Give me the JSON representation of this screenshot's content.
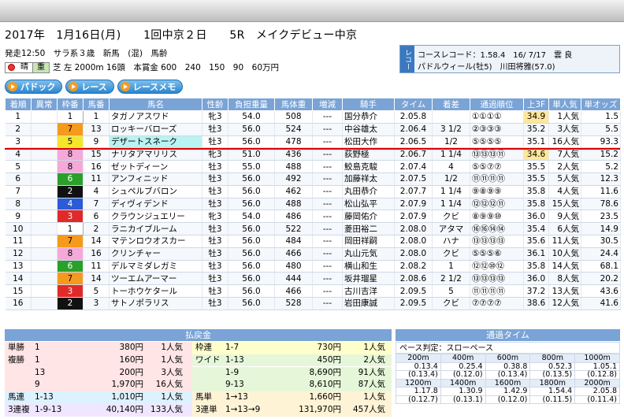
{
  "race": {
    "title": "2017年　1月16日(月)　　1回中京２日　　5R　メイクデビュー中京",
    "info1": "発走12:50　サラ系３歳　新馬　(混)　馬齢",
    "weather": "晴",
    "ground": "重",
    "info2": "芝 左 2000m 16頭　本賞金 600　240　150　90　60万円"
  },
  "record": {
    "tag": "レコード",
    "line1": "コースレコード：1.58.4　16/ 7/17　雲 良",
    "line2": "パドルウィール(牡5)　川田将雅(57.0)"
  },
  "buttons": [
    "パドック",
    "レース",
    "レースメモ"
  ],
  "columns": [
    "着順",
    "異常",
    "枠番",
    "馬番",
    "馬名",
    "性齢",
    "負担重量",
    "馬体重",
    "増減",
    "騎手",
    "タイム",
    "着差",
    "通過順位",
    "上3F",
    "単人気",
    "単オッズ"
  ],
  "rows": [
    [
      "1",
      "",
      "1",
      "1",
      "タガノアスワド",
      "牝3",
      "54.0",
      "508",
      "---",
      "国分恭介",
      "2.05.8",
      "",
      "①①①①",
      "34.9",
      "1人気",
      "1.5"
    ],
    [
      "2",
      "",
      "7",
      "13",
      "ロッキーバローズ",
      "牡3",
      "56.0",
      "524",
      "---",
      "中谷雄太",
      "2.06.4",
      "3 1/2",
      "②③③③",
      "35.2",
      "3人気",
      "5.5"
    ],
    [
      "3",
      "",
      "5",
      "9",
      "デザートスネーク",
      "牡3",
      "56.0",
      "478",
      "---",
      "松田大作",
      "2.06.5",
      "1/2",
      "⑤⑤⑤⑤",
      "35.1",
      "16人気",
      "93.3"
    ],
    [
      "4",
      "",
      "8",
      "15",
      "ナリタアマリリス",
      "牝3",
      "51.0",
      "436",
      "---",
      "荻野極",
      "2.06.7",
      "1 1/4",
      "⑬⑬⑬⑪",
      "34.6",
      "7人気",
      "15.2"
    ],
    [
      "5",
      "",
      "8",
      "16",
      "ゼットディーン",
      "牡3",
      "55.0",
      "488",
      "---",
      "鮫島克駿",
      "2.07.4",
      "4",
      "⑤⑤⑦⑦",
      "35.5",
      "2人気",
      "5.2"
    ],
    [
      "6",
      "",
      "6",
      "11",
      "アンフィニッド",
      "牡3",
      "56.0",
      "492",
      "---",
      "加藤祥太",
      "2.07.5",
      "1/2",
      "⑪⑪⑪⑪",
      "35.5",
      "5人気",
      "12.3"
    ],
    [
      "7",
      "",
      "2",
      "4",
      "シュペルブバロン",
      "牡3",
      "56.0",
      "462",
      "---",
      "丸田恭介",
      "2.07.7",
      "1 1/4",
      "⑨⑧⑨⑨",
      "35.8",
      "4人気",
      "11.6"
    ],
    [
      "8",
      "",
      "4",
      "7",
      "ディヴィデンド",
      "牡3",
      "56.0",
      "488",
      "---",
      "松山弘平",
      "2.07.9",
      "1 1/4",
      "⑫⑫⑫⑪",
      "35.8",
      "15人気",
      "78.6"
    ],
    [
      "9",
      "",
      "3",
      "6",
      "クラウンジュエリー",
      "牝3",
      "54.0",
      "486",
      "---",
      "藤岡佑介",
      "2.07.9",
      "クビ",
      "⑧⑨⑨⑩",
      "36.0",
      "9人気",
      "23.5"
    ],
    [
      "10",
      "",
      "1",
      "2",
      "ラニカイブルーム",
      "牡3",
      "56.0",
      "522",
      "---",
      "菱田裕二",
      "2.08.0",
      "アタマ",
      "⑯⑯⑭⑭",
      "35.4",
      "6人気",
      "14.9"
    ],
    [
      "11",
      "",
      "7",
      "14",
      "マテンロウオスカー",
      "牡3",
      "56.0",
      "484",
      "---",
      "岡田祥嗣",
      "2.08.0",
      "ハナ",
      "⑬⑬⑬⑬",
      "35.6",
      "11人気",
      "30.5"
    ],
    [
      "12",
      "",
      "8",
      "16",
      "クリンチャー",
      "牡3",
      "56.0",
      "466",
      "---",
      "丸山元気",
      "2.08.0",
      "クビ",
      "⑤⑤⑤⑥",
      "36.1",
      "10人気",
      "24.4"
    ],
    [
      "13",
      "",
      "6",
      "11",
      "デルマミダレガミ",
      "牡3",
      "56.0",
      "480",
      "---",
      "横山和生",
      "2.08.2",
      "1",
      "⑫⑫⑩⑫",
      "35.8",
      "14人気",
      "68.1"
    ],
    [
      "14",
      "",
      "7",
      "14",
      "ツーエムアーマー",
      "牡3",
      "56.0",
      "444",
      "---",
      "坂井瑠星",
      "2.08.6",
      "2 1/2",
      "⑬⑬⑬⑬",
      "36.0",
      "8人気",
      "20.2"
    ],
    [
      "15",
      "",
      "3",
      "5",
      "トーホウケタール",
      "牡3",
      "56.0",
      "466",
      "---",
      "古川吉洋",
      "2.09.5",
      "5",
      "⑪⑪⑪⑪",
      "37.2",
      "13人気",
      "43.6"
    ],
    [
      "16",
      "",
      "2",
      "3",
      "サトノポラリス",
      "牡3",
      "56.0",
      "528",
      "---",
      "岩田康誠",
      "2.09.5",
      "クビ",
      "⑦⑦⑦⑦",
      "38.6",
      "12人気",
      "41.6"
    ]
  ],
  "waku_colors": {
    "1": "#ffffff",
    "2": "#111111",
    "3": "#e02a2a",
    "4": "#2a5bd8",
    "5": "#f5e62a",
    "6": "#2aa02a",
    "7": "#f59a1c",
    "8": "#f5a9d8"
  },
  "payout": {
    "title": "払戻金",
    "left": [
      [
        "単勝",
        "1",
        "380円",
        "1人気"
      ],
      [
        "複勝",
        "1",
        "160円",
        "1人気"
      ],
      [
        "",
        "13",
        "200円",
        "3人気"
      ],
      [
        "",
        "9",
        "1,970円",
        "16人気"
      ],
      [
        "馬連",
        "1-13",
        "1,010円",
        "1人気"
      ],
      [
        "3連複",
        "1-9-13",
        "40,140円",
        "133人気"
      ]
    ],
    "right": [
      [
        "枠連",
        "1-7",
        "730円",
        "1人気"
      ],
      [
        "ワイド",
        "1-13",
        "450円",
        "2人気"
      ],
      [
        "",
        "1-9",
        "8,690円",
        "91人気"
      ],
      [
        "",
        "9-13",
        "8,610円",
        "87人気"
      ],
      [
        "馬単",
        "1→13",
        "1,660円",
        "1人気"
      ],
      [
        "3連単",
        "1→13→9",
        "131,970円",
        "457人気"
      ]
    ]
  },
  "laptime": {
    "title": "通過タイム",
    "pace": "ペース判定：スローペース",
    "dist1": [
      "200m",
      "400m",
      "600m",
      "800m",
      "1000m"
    ],
    "t1": [
      "0.13.4",
      "0.25.4",
      "0.38.8",
      "0.52.3",
      "1.05.1"
    ],
    "s1": [
      "(0.13.4)",
      "(0.12.0)",
      "(0.13.4)",
      "(0.13.5)",
      "(0.12.8)"
    ],
    "dist2": [
      "1200m",
      "1400m",
      "1600m",
      "1800m",
      "2000m"
    ],
    "t2": [
      "1.17.8",
      "1.30.9",
      "1.42.9",
      "1.54.4",
      "2.05.8"
    ],
    "s2": [
      "(0.12.7)",
      "(0.13.1)",
      "(0.12.0)",
      "(0.11.5)",
      "(0.11.4)"
    ]
  }
}
